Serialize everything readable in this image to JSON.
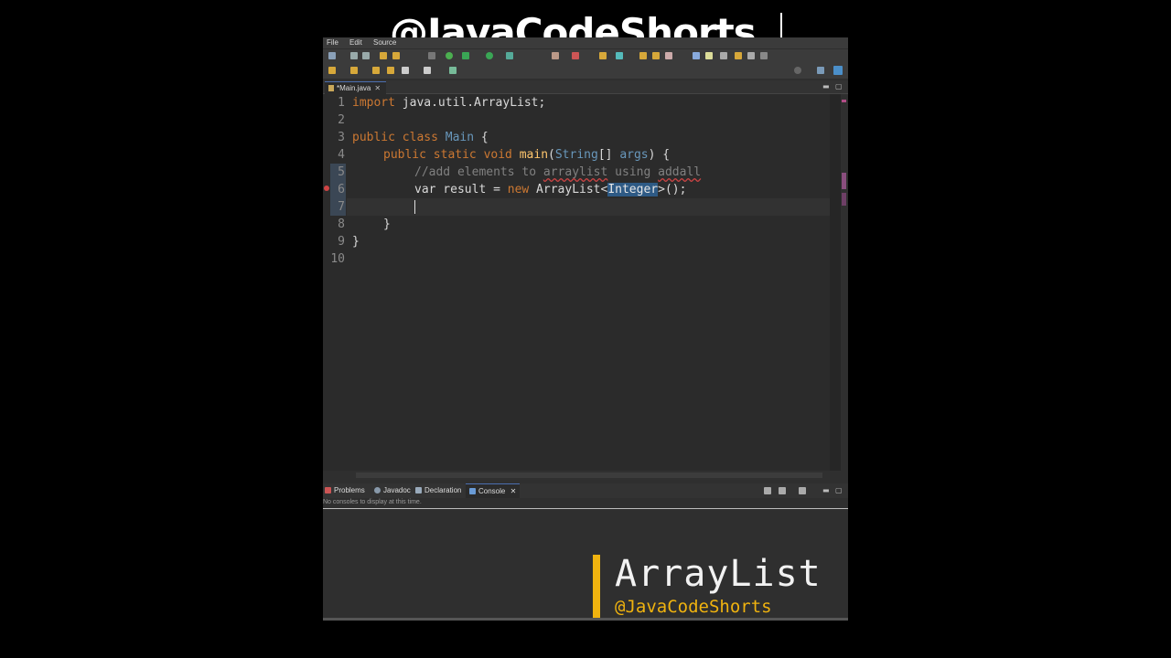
{
  "watermark": "@JavaCodeShorts",
  "menu": [
    "File",
    "Edit",
    "Source"
  ],
  "editor": {
    "tab_label": "*Main.java",
    "tab_close": "✕",
    "line_numbers": [
      "1",
      "2",
      "3",
      "4",
      "5",
      "6",
      "7",
      "8",
      "9",
      "10"
    ],
    "code": {
      "l1_kw": "import",
      "l1_rest": " java.util.ArrayList;",
      "l3_kw": "public class",
      "l3_cls": "Main",
      "l3_rest": " {",
      "l4_kw": "public static void",
      "l4_mth": "main",
      "l4_p1": "(",
      "l4_type": "String",
      "l4_p2": "[] ",
      "l4_arg": "args",
      "l4_p3": ") {",
      "l5_cm_a": "//add elements to ",
      "l5_cm_b": "arraylist",
      "l5_cm_c": " using ",
      "l5_cm_d": "addall",
      "l6_a": "var result = ",
      "l6_kw": "new",
      "l6_b": " ArrayList<",
      "l6_hl": "Integer",
      "l6_c": ">();",
      "l8": "}",
      "l9": "}"
    }
  },
  "panel": {
    "tabs": [
      "Problems",
      "Javadoc",
      "Declaration",
      "Console"
    ],
    "console_close": "✕",
    "console_message": "No consoles to display at this time."
  },
  "overlay": {
    "title": "ArrayList",
    "handle": "@JavaCodeShorts"
  },
  "colors": {
    "accent": "#f0b30f",
    "keyword": "#cc7832",
    "class": "#6897bb",
    "method": "#ffc66d"
  }
}
